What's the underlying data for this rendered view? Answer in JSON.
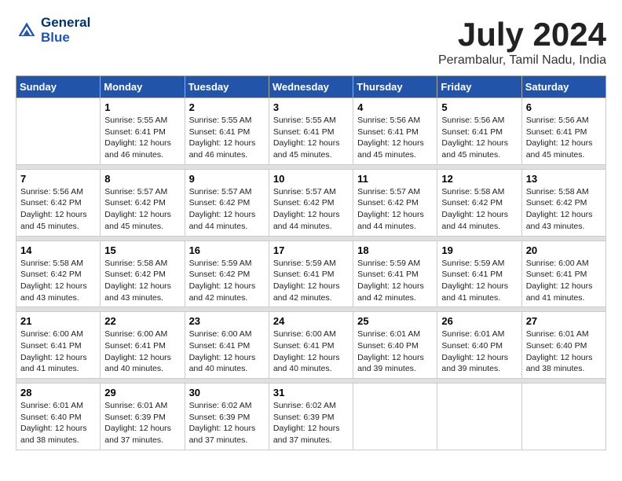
{
  "header": {
    "logo_line1": "General",
    "logo_line2": "Blue",
    "month": "July 2024",
    "location": "Perambalur, Tamil Nadu, India"
  },
  "columns": [
    "Sunday",
    "Monday",
    "Tuesday",
    "Wednesday",
    "Thursday",
    "Friday",
    "Saturday"
  ],
  "weeks": [
    [
      {
        "day": "",
        "sunrise": "",
        "sunset": "",
        "daylight": ""
      },
      {
        "day": "1",
        "sunrise": "Sunrise: 5:55 AM",
        "sunset": "Sunset: 6:41 PM",
        "daylight": "Daylight: 12 hours and 46 minutes."
      },
      {
        "day": "2",
        "sunrise": "Sunrise: 5:55 AM",
        "sunset": "Sunset: 6:41 PM",
        "daylight": "Daylight: 12 hours and 46 minutes."
      },
      {
        "day": "3",
        "sunrise": "Sunrise: 5:55 AM",
        "sunset": "Sunset: 6:41 PM",
        "daylight": "Daylight: 12 hours and 45 minutes."
      },
      {
        "day": "4",
        "sunrise": "Sunrise: 5:56 AM",
        "sunset": "Sunset: 6:41 PM",
        "daylight": "Daylight: 12 hours and 45 minutes."
      },
      {
        "day": "5",
        "sunrise": "Sunrise: 5:56 AM",
        "sunset": "Sunset: 6:41 PM",
        "daylight": "Daylight: 12 hours and 45 minutes."
      },
      {
        "day": "6",
        "sunrise": "Sunrise: 5:56 AM",
        "sunset": "Sunset: 6:41 PM",
        "daylight": "Daylight: 12 hours and 45 minutes."
      }
    ],
    [
      {
        "day": "7",
        "sunrise": "Sunrise: 5:56 AM",
        "sunset": "Sunset: 6:42 PM",
        "daylight": "Daylight: 12 hours and 45 minutes."
      },
      {
        "day": "8",
        "sunrise": "Sunrise: 5:57 AM",
        "sunset": "Sunset: 6:42 PM",
        "daylight": "Daylight: 12 hours and 45 minutes."
      },
      {
        "day": "9",
        "sunrise": "Sunrise: 5:57 AM",
        "sunset": "Sunset: 6:42 PM",
        "daylight": "Daylight: 12 hours and 44 minutes."
      },
      {
        "day": "10",
        "sunrise": "Sunrise: 5:57 AM",
        "sunset": "Sunset: 6:42 PM",
        "daylight": "Daylight: 12 hours and 44 minutes."
      },
      {
        "day": "11",
        "sunrise": "Sunrise: 5:57 AM",
        "sunset": "Sunset: 6:42 PM",
        "daylight": "Daylight: 12 hours and 44 minutes."
      },
      {
        "day": "12",
        "sunrise": "Sunrise: 5:58 AM",
        "sunset": "Sunset: 6:42 PM",
        "daylight": "Daylight: 12 hours and 44 minutes."
      },
      {
        "day": "13",
        "sunrise": "Sunrise: 5:58 AM",
        "sunset": "Sunset: 6:42 PM",
        "daylight": "Daylight: 12 hours and 43 minutes."
      }
    ],
    [
      {
        "day": "14",
        "sunrise": "Sunrise: 5:58 AM",
        "sunset": "Sunset: 6:42 PM",
        "daylight": "Daylight: 12 hours and 43 minutes."
      },
      {
        "day": "15",
        "sunrise": "Sunrise: 5:58 AM",
        "sunset": "Sunset: 6:42 PM",
        "daylight": "Daylight: 12 hours and 43 minutes."
      },
      {
        "day": "16",
        "sunrise": "Sunrise: 5:59 AM",
        "sunset": "Sunset: 6:42 PM",
        "daylight": "Daylight: 12 hours and 42 minutes."
      },
      {
        "day": "17",
        "sunrise": "Sunrise: 5:59 AM",
        "sunset": "Sunset: 6:41 PM",
        "daylight": "Daylight: 12 hours and 42 minutes."
      },
      {
        "day": "18",
        "sunrise": "Sunrise: 5:59 AM",
        "sunset": "Sunset: 6:41 PM",
        "daylight": "Daylight: 12 hours and 42 minutes."
      },
      {
        "day": "19",
        "sunrise": "Sunrise: 5:59 AM",
        "sunset": "Sunset: 6:41 PM",
        "daylight": "Daylight: 12 hours and 41 minutes."
      },
      {
        "day": "20",
        "sunrise": "Sunrise: 6:00 AM",
        "sunset": "Sunset: 6:41 PM",
        "daylight": "Daylight: 12 hours and 41 minutes."
      }
    ],
    [
      {
        "day": "21",
        "sunrise": "Sunrise: 6:00 AM",
        "sunset": "Sunset: 6:41 PM",
        "daylight": "Daylight: 12 hours and 41 minutes."
      },
      {
        "day": "22",
        "sunrise": "Sunrise: 6:00 AM",
        "sunset": "Sunset: 6:41 PM",
        "daylight": "Daylight: 12 hours and 40 minutes."
      },
      {
        "day": "23",
        "sunrise": "Sunrise: 6:00 AM",
        "sunset": "Sunset: 6:41 PM",
        "daylight": "Daylight: 12 hours and 40 minutes."
      },
      {
        "day": "24",
        "sunrise": "Sunrise: 6:00 AM",
        "sunset": "Sunset: 6:41 PM",
        "daylight": "Daylight: 12 hours and 40 minutes."
      },
      {
        "day": "25",
        "sunrise": "Sunrise: 6:01 AM",
        "sunset": "Sunset: 6:40 PM",
        "daylight": "Daylight: 12 hours and 39 minutes."
      },
      {
        "day": "26",
        "sunrise": "Sunrise: 6:01 AM",
        "sunset": "Sunset: 6:40 PM",
        "daylight": "Daylight: 12 hours and 39 minutes."
      },
      {
        "day": "27",
        "sunrise": "Sunrise: 6:01 AM",
        "sunset": "Sunset: 6:40 PM",
        "daylight": "Daylight: 12 hours and 38 minutes."
      }
    ],
    [
      {
        "day": "28",
        "sunrise": "Sunrise: 6:01 AM",
        "sunset": "Sunset: 6:40 PM",
        "daylight": "Daylight: 12 hours and 38 minutes."
      },
      {
        "day": "29",
        "sunrise": "Sunrise: 6:01 AM",
        "sunset": "Sunset: 6:39 PM",
        "daylight": "Daylight: 12 hours and 37 minutes."
      },
      {
        "day": "30",
        "sunrise": "Sunrise: 6:02 AM",
        "sunset": "Sunset: 6:39 PM",
        "daylight": "Daylight: 12 hours and 37 minutes."
      },
      {
        "day": "31",
        "sunrise": "Sunrise: 6:02 AM",
        "sunset": "Sunset: 6:39 PM",
        "daylight": "Daylight: 12 hours and 37 minutes."
      },
      {
        "day": "",
        "sunrise": "",
        "sunset": "",
        "daylight": ""
      },
      {
        "day": "",
        "sunrise": "",
        "sunset": "",
        "daylight": ""
      },
      {
        "day": "",
        "sunrise": "",
        "sunset": "",
        "daylight": ""
      }
    ]
  ]
}
